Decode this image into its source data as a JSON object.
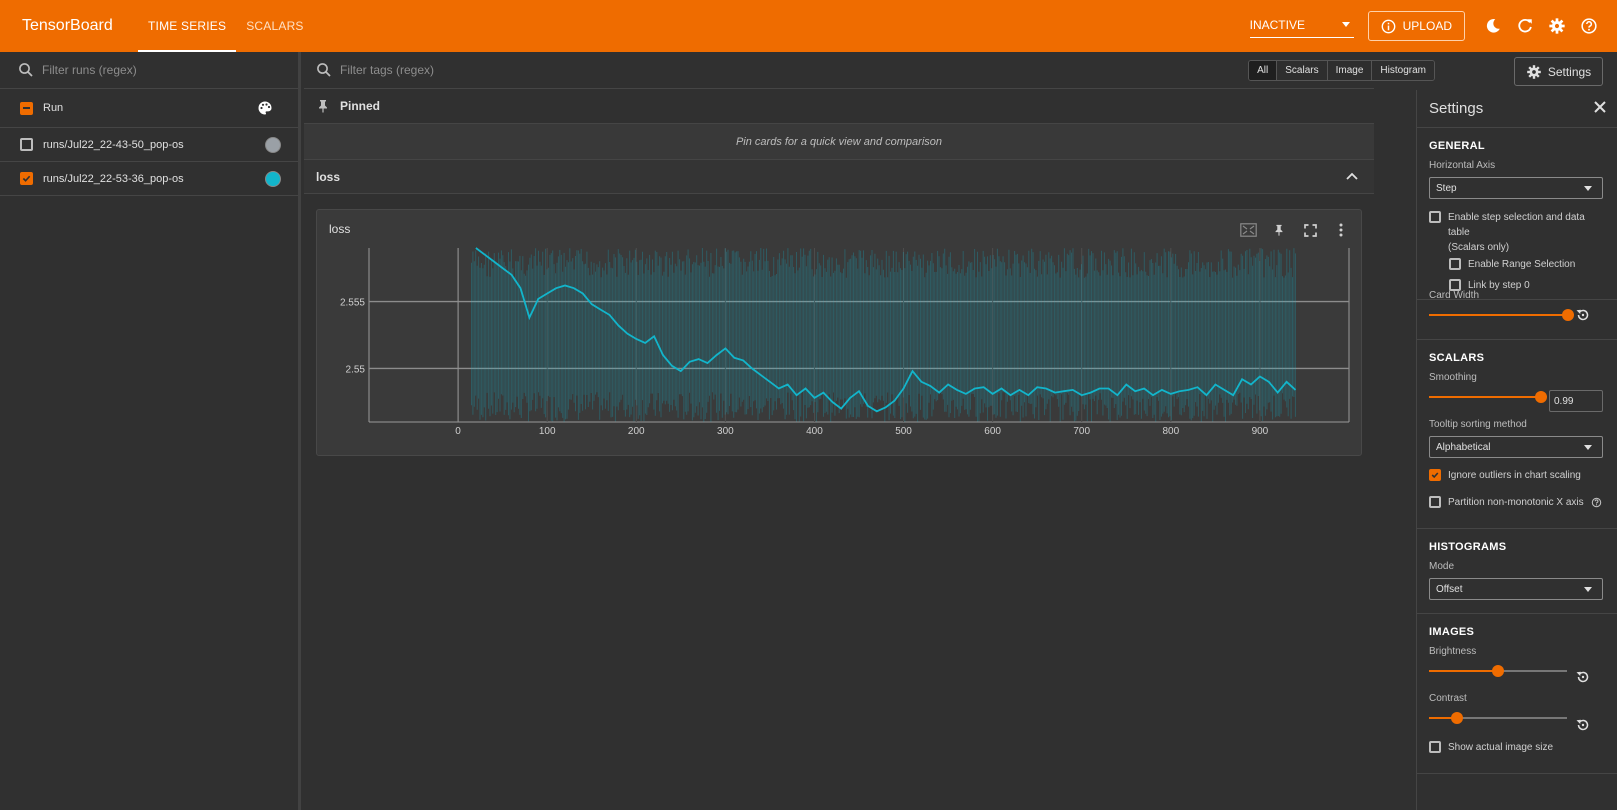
{
  "app": {
    "title": "TensorBoard"
  },
  "nav": {
    "tabs": [
      {
        "label": "TIME SERIES",
        "active": true
      },
      {
        "label": "SCALARS",
        "active": false
      }
    ]
  },
  "topbar": {
    "status_select": "INACTIVE",
    "upload_label": "UPLOAD"
  },
  "runs": {
    "filter_placeholder": "Filter runs (regex)",
    "header_label": "Run",
    "items": [
      {
        "name": "runs/Jul22_22-43-50_pop-os",
        "checked": false,
        "color": "#9aa0a6"
      },
      {
        "name": "runs/Jul22_22-53-36_pop-os",
        "checked": true,
        "color": "#12b5cb"
      }
    ]
  },
  "main": {
    "filter_placeholder": "Filter tags (regex)",
    "type_filters": [
      "All",
      "Scalars",
      "Image",
      "Histogram"
    ],
    "pinned_label": "Pinned",
    "pinned_empty": "Pin cards for a quick view and comparison",
    "group_label": "loss",
    "card_title": "loss"
  },
  "settings_button_label": "Settings",
  "settings": {
    "title": "Settings",
    "general": {
      "heading": "GENERAL",
      "horizontal_axis_label": "Horizontal Axis",
      "horizontal_axis_value": "Step",
      "enable_step_selection": "Enable step selection and data table",
      "enable_step_selection_2": "(Scalars only)",
      "enable_range_selection": "Enable Range Selection",
      "link_by_step": "Link by step 0",
      "card_width_label": "Card Width",
      "card_width": 1.0
    },
    "scalars": {
      "heading": "SCALARS",
      "smoothing_label": "Smoothing",
      "smoothing_value": "0.99",
      "tooltip_sort_label": "Tooltip sorting method",
      "tooltip_sort_value": "Alphabetical",
      "ignore_outliers": "Ignore outliers in chart scaling",
      "partition": "Partition non-monotonic X axis"
    },
    "histograms": {
      "heading": "HISTOGRAMS",
      "mode_label": "Mode",
      "mode_value": "Offset"
    },
    "images": {
      "heading": "IMAGES",
      "brightness_label": "Brightness",
      "brightness": 0.5,
      "contrast_label": "Contrast",
      "contrast": 0.2,
      "show_actual_size": "Show actual image size"
    }
  },
  "chart_data": {
    "type": "line",
    "title": "loss",
    "xlabel": "",
    "ylabel": "",
    "x_ticks": [
      "0",
      "100",
      "200",
      "300",
      "400",
      "500",
      "600",
      "700",
      "800",
      "900"
    ],
    "y_ticks": [
      "2.555",
      "2.55"
    ],
    "xlim": [
      -100,
      1000
    ],
    "ylim": [
      2.546,
      2.559
    ],
    "series": [
      {
        "name": "runs/Jul22_22-53-36_pop-os",
        "color": "#12b5cb",
        "x": [
          20,
          30,
          40,
          50,
          60,
          70,
          80,
          90,
          100,
          110,
          120,
          130,
          140,
          150,
          160,
          170,
          180,
          190,
          200,
          210,
          220,
          230,
          240,
          250,
          260,
          270,
          280,
          290,
          300,
          310,
          320,
          330,
          340,
          350,
          360,
          370,
          380,
          390,
          400,
          410,
          420,
          430,
          440,
          450,
          460,
          470,
          480,
          490,
          500,
          510,
          520,
          530,
          540,
          550,
          560,
          570,
          580,
          590,
          600,
          610,
          620,
          630,
          640,
          650,
          660,
          670,
          680,
          690,
          700,
          710,
          720,
          730,
          740,
          750,
          760,
          770,
          780,
          790,
          800,
          810,
          820,
          830,
          840,
          850,
          860,
          870,
          880,
          890,
          900,
          910,
          920,
          930,
          940
        ],
        "y": [
          2.559,
          2.5585,
          2.558,
          2.5575,
          2.557,
          2.556,
          2.5538,
          2.5552,
          2.5556,
          2.556,
          2.5562,
          2.556,
          2.5556,
          2.5548,
          2.5544,
          2.554,
          2.5532,
          2.5526,
          2.5522,
          2.5519,
          2.5524,
          2.551,
          2.5502,
          2.5498,
          2.5505,
          2.5507,
          2.5504,
          2.551,
          2.5515,
          2.5508,
          2.5506,
          2.55,
          2.5495,
          2.549,
          2.5485,
          2.5488,
          2.548,
          2.5485,
          2.5478,
          2.5482,
          2.5475,
          2.547,
          2.5478,
          2.5483,
          2.5472,
          2.5468,
          2.5471,
          2.5476,
          2.5485,
          2.5498,
          2.549,
          2.5487,
          2.5482,
          2.5488,
          2.5484,
          2.5481,
          2.5485,
          2.5486,
          2.5481,
          2.5485,
          2.548,
          2.5484,
          2.548,
          2.5486,
          2.5485,
          2.5482,
          2.5483,
          2.5484,
          2.548,
          2.5482,
          2.5485,
          2.5485,
          2.548,
          2.5488,
          2.5483,
          2.5485,
          2.548,
          2.5484,
          2.5481,
          2.5483,
          2.5484,
          2.5486,
          2.548,
          2.5488,
          2.5484,
          2.548,
          2.5492,
          2.5488,
          2.5494,
          2.549,
          2.5482,
          2.549,
          2.5484
        ]
      }
    ]
  }
}
